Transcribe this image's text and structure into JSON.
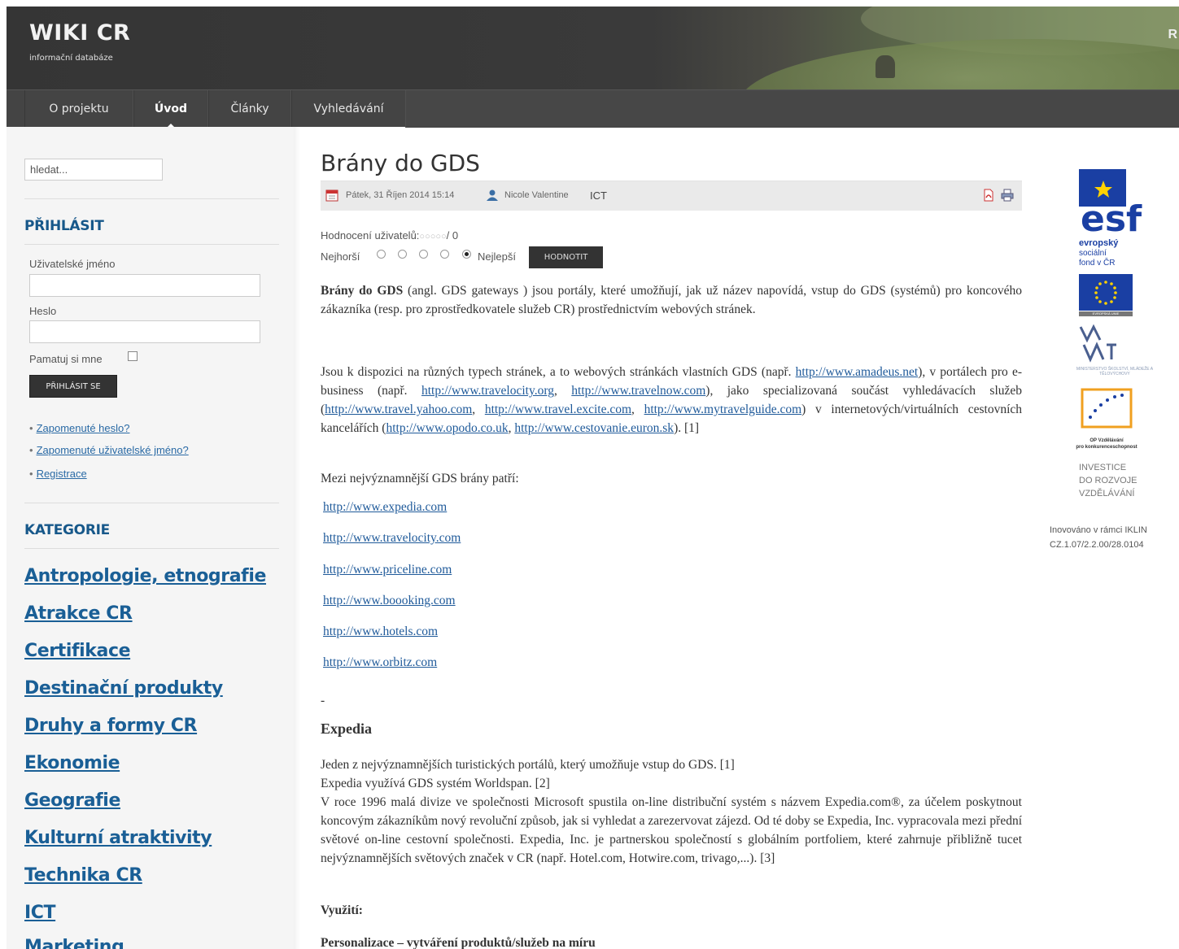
{
  "header": {
    "title": "WIKI CR",
    "subtitle": "informační databáze",
    "edge_text": "R"
  },
  "nav": {
    "items": [
      {
        "label": "O projektu"
      },
      {
        "label": "Úvod"
      },
      {
        "label": "Články"
      },
      {
        "label": "Vyhledávání"
      }
    ]
  },
  "sidebar": {
    "search_placeholder": "hledat...",
    "login": {
      "heading": "PŘIHLÁSIT",
      "username_label": "Uživatelské jméno",
      "password_label": "Heslo",
      "remember_label": "Pamatuj si mne",
      "button_label": "PŘIHLÁSIT SE",
      "links": [
        "Zapomenuté heslo?",
        "Zapomenuté uživatelské jméno?",
        "Registrace"
      ]
    },
    "categories": {
      "heading": "KATEGORIE",
      "items": [
        "Antropologie, etnografie",
        "Atrakce CR",
        "Certifikace",
        "Destinační produkty",
        "Druhy a formy CR",
        "Ekonomie",
        "Geografie",
        "Kulturní atraktivity",
        "Technika CR",
        "ICT",
        "Marketing"
      ]
    }
  },
  "article": {
    "title": "Brány do GDS",
    "date": "Pátek, 31 Říjen 2014 15:14",
    "author": "Nicole Valentine",
    "category": "ICT",
    "rating_label": "Hodnocení uživatelů:",
    "rating_stars": "○○○○○",
    "rating_value": "/ 0",
    "worst_label": "Nejhorší",
    "best_label": "Nejlepší",
    "rate_button": "HODNOTIT",
    "intro_bold": "Brány do GDS",
    "intro_rest": " (angl. GDS gateways ) jsou portály, které umožňují, jak už název napovídá, vstup do GDS (systémů) pro koncového zákazníka (resp. pro zprostředkovatele služeb CR) prostřednictvím webových stránek.",
    "p2_a": "Jsou k dispozici na různých typech stránek, a to webových stránkách vlastních GDS (např.",
    "p2_link1": "http://www.amadeus.net",
    "p2_b": "), v portálech pro e-business (např.",
    "p2_link2": "http://www.travelocity.org",
    "p2_c": ",",
    "p2_link3": "http://www.travelnow.com",
    "p2_d": "), jako specializovaná součást vyhledávacích služeb (",
    "p2_link4": "http://www.travel.yahoo.com",
    "p2_e": ",",
    "p2_link5": "http://www.travel.excite.com",
    "p2_f": ",",
    "p2_link6": "http://www.mytravelguide.com",
    "p2_g": ") v internetových/virtuálních cestovních kancelářích (",
    "p2_link7": "http://www.opodo.co.uk",
    "p2_h": ",",
    "p2_link8": "http://www.cestovanie.euron.sk",
    "p2_i": "). [1]",
    "list_intro": "Mezi nejvýznamnější GDS brány patří:",
    "gds_links": [
      "http://www.expedia.com",
      "http://www.travelocity.com",
      "http://www.priceline.com",
      "http://www.boooking.com",
      "http://www.hotels.com",
      "http://www.orbitz.com"
    ],
    "dash": "-",
    "expedia_heading": "Expedia",
    "expedia_l1": "Jeden z nejvýznamnějších turistických portálů, který umožňuje vstup do GDS. [1]",
    "expedia_l2": "Expedia využívá GDS systém Worldspan. [2]",
    "expedia_l3": "V roce 1996 malá divize ve společnosti Microsoft spustila on-line distribuční systém s názvem Expedia.com®, za účelem poskytnout koncovým zákazníkům nový revoluční způsob, jak si vyhledat a zarezervovat zájezd. Od té doby se Expedia, Inc. vypracovala mezi přední světové on-line cestovní společnosti. Expedia, Inc. je partnerskou společností s globálním portfoliem, které zahrnuje přibližně tucet nejvýznamnějších světových značek v CR (např. Hotel.com, Hotwire.com, trivago,...). [3]",
    "vyuziti_heading": "Využití:",
    "personalizace": "Personalizace – vytváření produktů/služeb na míru"
  },
  "right_column": {
    "esf_text": "esf",
    "esf_lines": [
      "evropský",
      "sociální",
      "fond v ČR"
    ],
    "eu_caption": "EVROPSKÁ UNIE",
    "msmt_caption": "MINISTERSTVO ŠKOLSTVÍ, MLÁDEŽE A TĚLOVÝCHOVY",
    "op_caption_1": "OP Vzdělávání",
    "op_caption_2": "pro konkurenceschopnost",
    "invest_lines": [
      "INVESTICE",
      "DO ROZVOJE",
      "VZDĚLÁVÁNÍ"
    ],
    "innov_line1": "Inovováno v rámci IKLIN",
    "innov_line2": "CZ.1.07/2.2.00/28.0104"
  },
  "colors": {
    "nav_bg": "#444444",
    "link": "#1f5a9a",
    "sidebar_heading": "#17588a",
    "button_dark": "#333333",
    "esf_blue": "#1a3fa3"
  }
}
